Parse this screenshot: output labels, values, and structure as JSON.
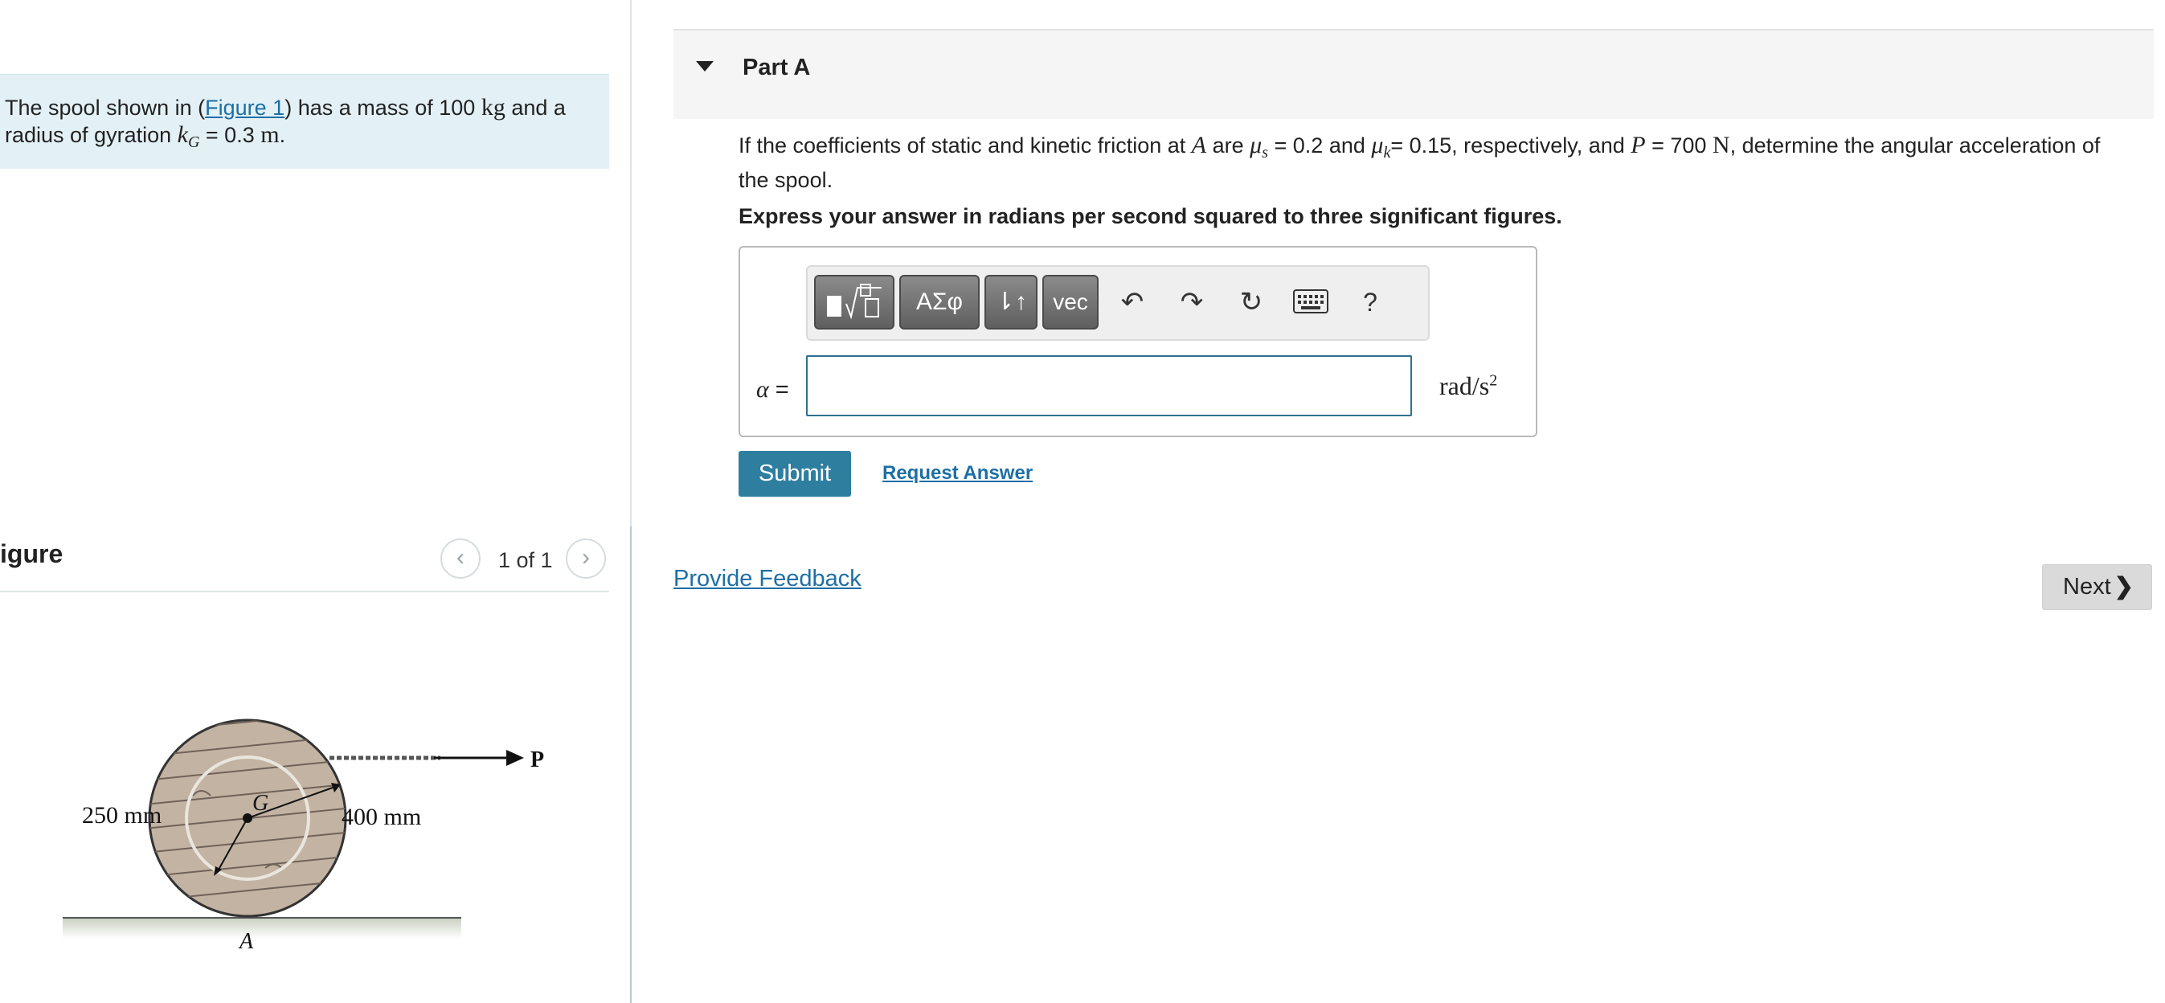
{
  "intro": {
    "text_before_link": "The spool shown in (",
    "link": "Figure 1",
    "text_after_link": ") has a mass of 100 ",
    "mass_unit": "kg",
    "text_mid": " and a radius of gyration ",
    "k_symbol": "k",
    "k_sub": "G",
    "k_value": " = 0.3 ",
    "k_unit": "m",
    "end": "."
  },
  "figure_panel": {
    "heading": "igure",
    "pager_text": "1 of 1",
    "prev_icon": "chevron-left-icon",
    "next_icon": "chevron-right-icon",
    "labels": {
      "p": "P",
      "g": "G",
      "a": "A",
      "inner_dim": "250 mm",
      "outer_dim": "400 mm"
    }
  },
  "part": {
    "title": "Part A",
    "question_start": "If the coefficients of static and kinetic friction at ",
    "point": "A",
    "are": " are ",
    "mu": "μ",
    "mu_s_sub": "s",
    "mu_s_value": " = 0.2 and ",
    "mu_k_sub": "k",
    "mu_k_value": "= 0.15, respectively, and ",
    "p": "P",
    "p_value": " = 700 ",
    "p_unit": "N",
    "question_end": ", determine the angular acceleration of the spool.",
    "instruction": "Express your answer in radians per second squared to three significant figures."
  },
  "toolbar": {
    "templates_icon": "templates-icon",
    "greek_label": "ΑΣφ",
    "arrows_label": "⇂↑",
    "vec_label": "vec",
    "undo_icon": "↶",
    "redo_icon": "↷",
    "reset_icon": "↻",
    "keyboard_icon": "keyboard-icon",
    "help_label": "?"
  },
  "answer": {
    "variable": "α",
    "equals": " =",
    "value": "",
    "unit": "rad/s",
    "unit_exp": "2"
  },
  "actions": {
    "submit": "Submit",
    "request": "Request Answer",
    "feedback": "Provide Feedback",
    "next": "Next",
    "next_chevron": "❯"
  },
  "colors": {
    "accent": "#2e7ea0",
    "link": "#1d6fa5",
    "intro_bg": "#e3f1f6"
  }
}
